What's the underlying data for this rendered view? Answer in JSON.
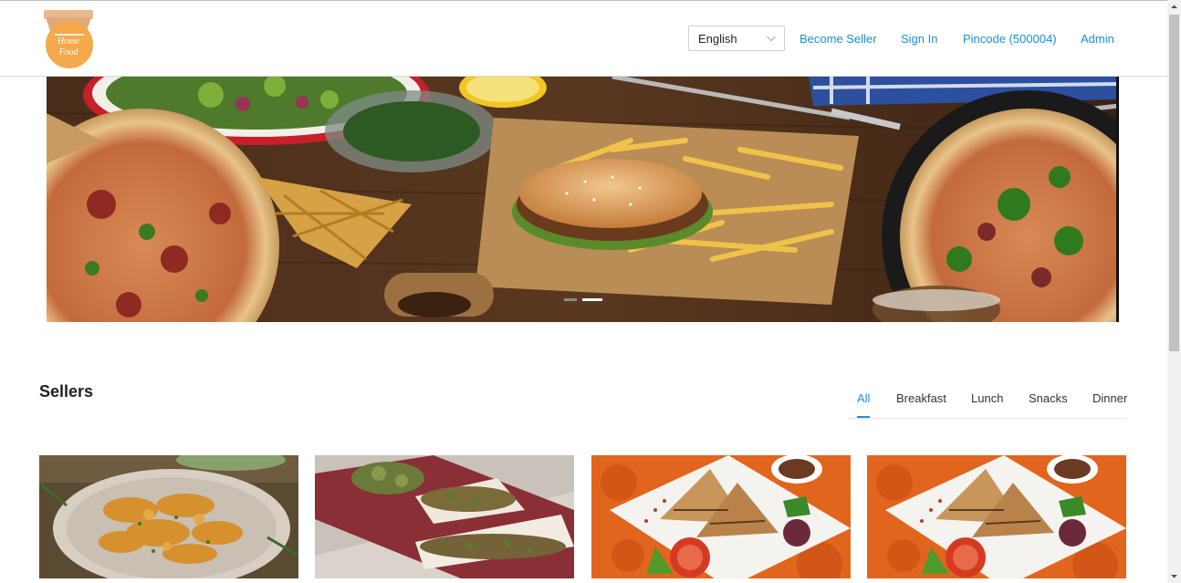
{
  "logo": {
    "line1": "Home",
    "line2": "Food"
  },
  "header": {
    "language": "English",
    "links": {
      "become_seller": "Become Seller",
      "sign_in": "Sign In",
      "pincode": "Pincode (500004)",
      "admin": "Admin"
    }
  },
  "hero": {
    "slide_count": 2,
    "active_slide": 2
  },
  "section": {
    "title": "Sellers",
    "tabs": [
      "All",
      "Breakfast",
      "Lunch",
      "Snacks",
      "Dinner"
    ],
    "active_tab": "All"
  },
  "cards": [
    {
      "image": "chicken-dish-plate"
    },
    {
      "image": "stuffed-wraps"
    },
    {
      "image": "grilled-sandwich"
    },
    {
      "image": "grilled-sandwich"
    }
  ],
  "colors": {
    "accent": "#1a8fd8",
    "logo_orange": "#f5a94a"
  }
}
